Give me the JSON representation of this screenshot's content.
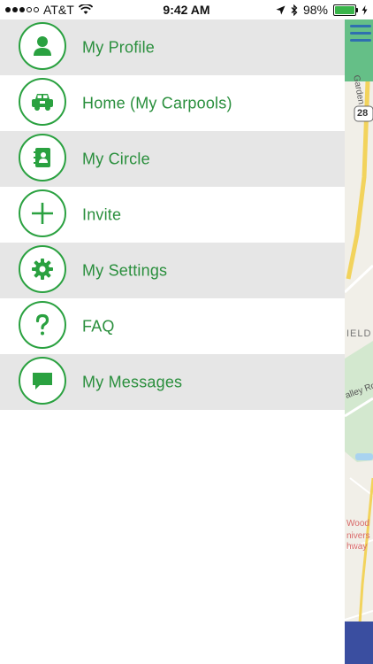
{
  "status_bar": {
    "carrier": "AT&T",
    "time": "9:42 AM",
    "battery": "98%"
  },
  "menu": [
    {
      "label": "My Profile",
      "icon": "user-icon"
    },
    {
      "label": "Home (My Carpools)",
      "icon": "car-icon"
    },
    {
      "label": "My Circle",
      "icon": "contacts-book-icon"
    },
    {
      "label": "Invite",
      "icon": "plus-icon"
    },
    {
      "label": "My Settings",
      "icon": "gear-icon"
    },
    {
      "label": "FAQ",
      "icon": "question-icon"
    },
    {
      "label": "My Messages",
      "icon": "message-icon"
    }
  ],
  "map": {
    "road_labels": [
      "Garden",
      "28",
      "IELD",
      "alley Ro",
      "Wood",
      "nivers",
      "hway"
    ]
  },
  "colors": {
    "accent": "#2aa140",
    "row_shade": "#e6e6e6",
    "map_header": "#65bf87",
    "menu_icon": "#2f6fb0"
  }
}
